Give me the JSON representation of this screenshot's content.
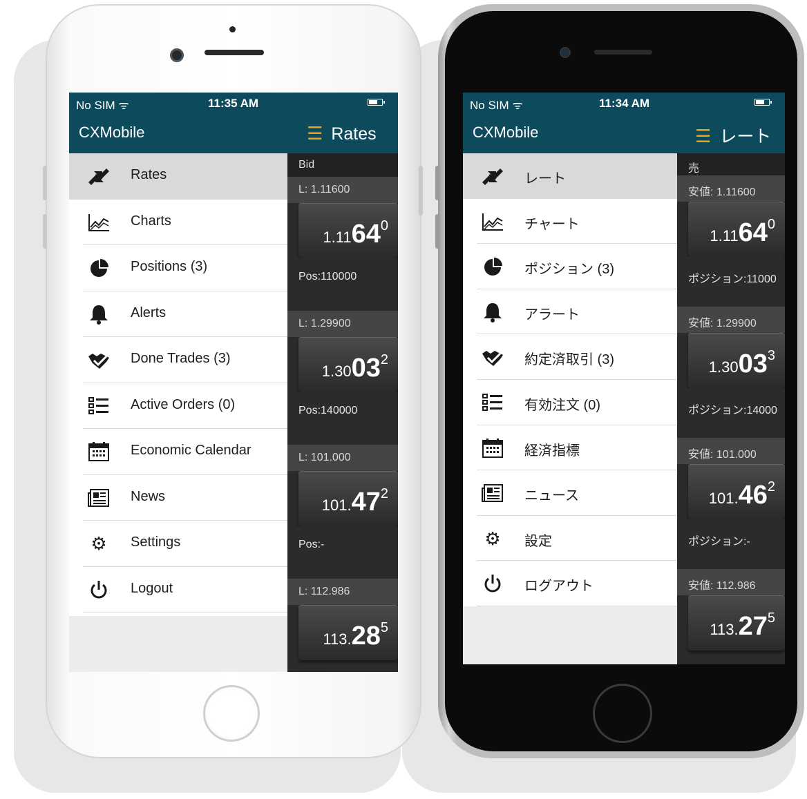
{
  "colors": {
    "header": "#0d4a5c",
    "accent": "#f0a21c",
    "rate_panel": "#2b2b2b"
  },
  "phones": [
    {
      "status": {
        "carrier": "No SIM ᯤ",
        "time": "11:35 AM"
      },
      "app_title": "CXMobile",
      "rates_title": "Rates",
      "bid_label": "Bid",
      "menu": [
        {
          "icon": "rates-icon",
          "label": "Rates",
          "active": true
        },
        {
          "icon": "charts-icon",
          "label": "Charts"
        },
        {
          "icon": "pie-chart-icon",
          "label": "Positions (3)"
        },
        {
          "icon": "bell-icon",
          "label": "Alerts"
        },
        {
          "icon": "handshake-icon",
          "label": "Done Trades (3)"
        },
        {
          "icon": "list-icon",
          "label": "Active Orders (0)"
        },
        {
          "icon": "calendar-icon",
          "label": "Economic Calendar"
        },
        {
          "icon": "news-icon",
          "label": "News"
        },
        {
          "icon": "gear-icon",
          "label": "Settings"
        },
        {
          "icon": "power-icon",
          "label": "Logout"
        }
      ],
      "rates": [
        {
          "low": "L: 1.11600",
          "pre": "1.11",
          "big": "64",
          "sup": "0",
          "pos": "Pos:110000"
        },
        {
          "low": "L: 1.29900",
          "pre": "1.30",
          "big": "03",
          "sup": "2",
          "pos": "Pos:140000"
        },
        {
          "low": "L: 101.000",
          "pre": "101.",
          "big": "47",
          "sup": "2",
          "pos": "Pos:-"
        },
        {
          "low": "L: 112.986",
          "pre": "113.",
          "big": "28",
          "sup": "5",
          "pos": ""
        }
      ]
    },
    {
      "status": {
        "carrier": "No SIM ᯤ",
        "time": "11:34 AM"
      },
      "app_title": "CXMobile",
      "rates_title": "レート",
      "bid_label": "売",
      "menu": [
        {
          "icon": "rates-icon",
          "label": "レート",
          "active": true
        },
        {
          "icon": "charts-icon",
          "label": "チャート"
        },
        {
          "icon": "pie-chart-icon",
          "label": "ポジション (3)"
        },
        {
          "icon": "bell-icon",
          "label": "アラート"
        },
        {
          "icon": "handshake-icon",
          "label": "約定済取引 (3)"
        },
        {
          "icon": "list-icon",
          "label": "有効注文 (0)"
        },
        {
          "icon": "calendar-icon",
          "label": "経済指標"
        },
        {
          "icon": "news-icon",
          "label": "ニュース"
        },
        {
          "icon": "gear-icon",
          "label": "設定"
        },
        {
          "icon": "power-icon",
          "label": "ログアウト"
        }
      ],
      "rates": [
        {
          "low": "安値: 1.11600",
          "pre": "1.11",
          "big": "64",
          "sup": "0",
          "pos": "ポジション:11000"
        },
        {
          "low": "安値: 1.29900",
          "pre": "1.30",
          "big": "03",
          "sup": "3",
          "pos": "ポジション:14000"
        },
        {
          "low": "安値: 101.000",
          "pre": "101.",
          "big": "46",
          "sup": "2",
          "pos": "ポジション:-"
        },
        {
          "low": "安値: 112.986",
          "pre": "113.",
          "big": "27",
          "sup": "5",
          "pos": ""
        }
      ]
    }
  ]
}
